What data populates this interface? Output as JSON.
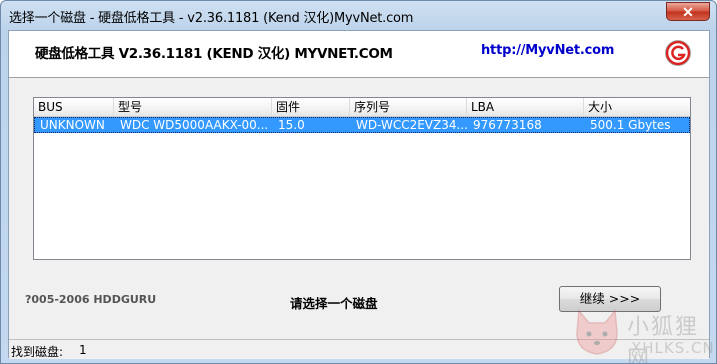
{
  "window": {
    "title": "选择一个磁盘 - 硬盘低格工具 - v2.36.1181 (Kend 汉化)MyvNet.com",
    "close_label": "✕"
  },
  "header": {
    "app_title": "硬盘低格工具 V2.36.1181 (KEND 汉化) MYVNET.COM",
    "site_link": "http://MyvNet.com",
    "logo_icon": "g-logo-icon"
  },
  "disk_list": {
    "columns": [
      "BUS",
      "型号",
      "固件",
      "序列号",
      "LBA",
      "大小"
    ],
    "rows": [
      {
        "bus": "UNKNOWN",
        "model": "WDC WD5000AAKX-00...",
        "firmware": "15.0",
        "serial": "WD-WCC2EVZ34...",
        "lba": "976773168",
        "size": "500.1 Gbytes",
        "selected": true
      }
    ]
  },
  "footer": {
    "copyright": "?005-2006 HDDGURU",
    "prompt": "请选择一个磁盘",
    "continue_label": "继续 >>>"
  },
  "statusbar": {
    "label": "找到磁盘:",
    "count": "1"
  },
  "watermark": {
    "cn": "小狐狸网",
    "en": "XHLKS.CN",
    "icon": "fox-icon"
  },
  "colors": {
    "selection": "#3399ff",
    "link": "#0000cc",
    "close": "#c0301c"
  }
}
